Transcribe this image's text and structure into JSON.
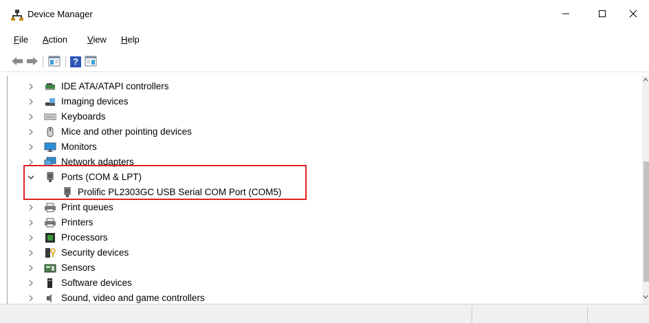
{
  "window": {
    "title": "Device Manager"
  },
  "controls": {
    "minimize": "—",
    "maximize": "☐",
    "close": "✕"
  },
  "menu": {
    "file": {
      "accel": "F",
      "rest": "ile"
    },
    "action": {
      "accel": "A",
      "rest": "ction"
    },
    "view": {
      "accel": "V",
      "rest": "iew"
    },
    "help": {
      "accel": "H",
      "rest": "elp"
    }
  },
  "toolbar": {
    "help_glyph": "?"
  },
  "tree": {
    "items": [
      {
        "label": "IDE ATA/ATAPI controllers",
        "icon": "ide-controller-icon",
        "expanded": false
      },
      {
        "label": "Imaging devices",
        "icon": "imaging-icon",
        "expanded": false
      },
      {
        "label": "Keyboards",
        "icon": "keyboard-icon",
        "expanded": false
      },
      {
        "label": "Mice and other pointing devices",
        "icon": "mouse-icon",
        "expanded": false
      },
      {
        "label": "Monitors",
        "icon": "monitor-icon",
        "expanded": false
      },
      {
        "label": "Network adapters",
        "icon": "network-icon",
        "expanded": false
      },
      {
        "label": "Ports (COM & LPT)",
        "icon": "port-icon",
        "expanded": true,
        "children": [
          {
            "label": "Prolific PL2303GC USB Serial COM Port (COM5)",
            "icon": "port-icon"
          }
        ]
      },
      {
        "label": "Print queues",
        "icon": "printer-icon",
        "expanded": false
      },
      {
        "label": "Printers",
        "icon": "printer-icon",
        "expanded": false
      },
      {
        "label": "Processors",
        "icon": "processor-icon",
        "expanded": false
      },
      {
        "label": "Security devices",
        "icon": "security-icon",
        "expanded": false
      },
      {
        "label": "Sensors",
        "icon": "sensor-icon",
        "expanded": false
      },
      {
        "label": "Software devices",
        "icon": "software-device-icon",
        "expanded": false
      },
      {
        "label": "Sound, video and game controllers",
        "icon": "sound-icon",
        "expanded": false
      }
    ]
  },
  "colors": {
    "highlight": "#e02020",
    "accent": "#1c6fd1"
  }
}
